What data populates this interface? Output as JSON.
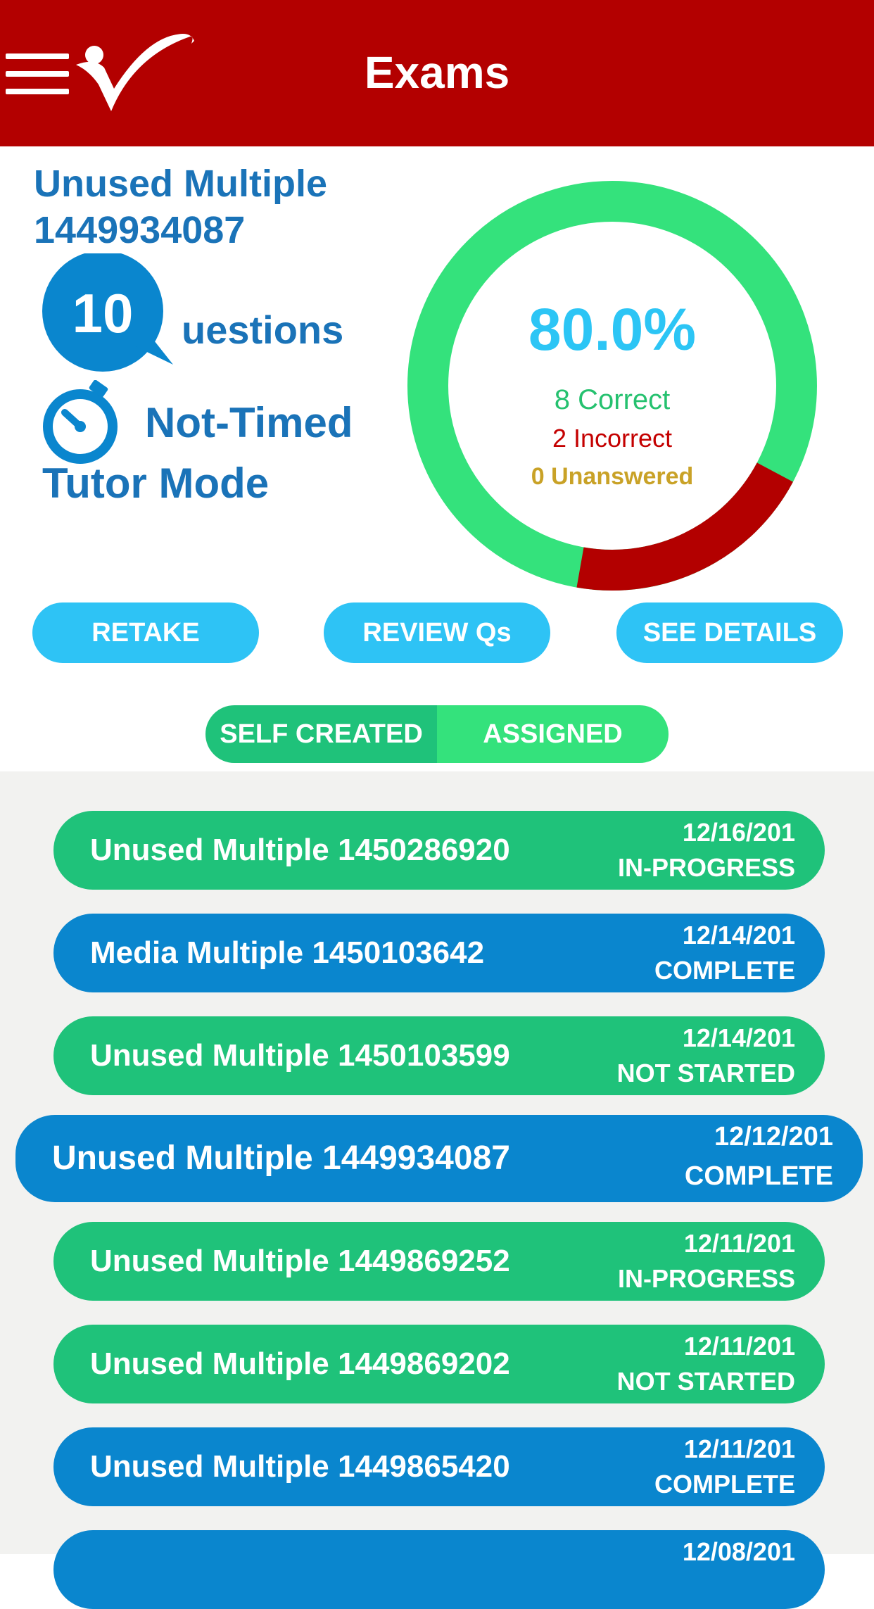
{
  "header": {
    "title": "Exams",
    "menu_icon": "hamburger-menu-icon",
    "logo_icon": "checkmark-person-logo"
  },
  "summary": {
    "exam_name": "Unused Multiple 1449934087",
    "question_count": "10",
    "question_suffix": "uestions",
    "timing": "Not-Timed",
    "mode": "Tutor Mode",
    "score_percent": "80.0%",
    "correct_label": "8 Correct",
    "incorrect_label": "2 Incorrect",
    "unanswered_label": "0 Unanswered",
    "correct_fraction": 0.8,
    "incorrect_fraction": 0.2,
    "colors": {
      "correct": "#34e27c",
      "incorrect": "#b30000",
      "accent": "#2ec3f5",
      "text": "#1a73b8"
    }
  },
  "actions": {
    "retake": "RETAKE",
    "review": "REVIEW Qs",
    "details": "SEE DETAILS"
  },
  "toggle": {
    "self_created": "SELF CREATED",
    "assigned": "ASSIGNED",
    "active": "self_created"
  },
  "exams": [
    {
      "name": "Unused Multiple 1450286920",
      "date": "12/16/201",
      "status": "IN-PROGRESS",
      "color": "#1fc27a"
    },
    {
      "name": "Media Multiple 1450103642",
      "date": "12/14/201",
      "status": "COMPLETE",
      "color": "#0a86ce"
    },
    {
      "name": "Unused Multiple 1450103599",
      "date": "12/14/201",
      "status": "NOT STARTED",
      "color": "#1fc27a"
    },
    {
      "name": "Unused Multiple 1449934087",
      "date": "12/12/201",
      "status": "COMPLETE",
      "color": "#0a86ce",
      "selected": true
    },
    {
      "name": "Unused Multiple 1449869252",
      "date": "12/11/201",
      "status": "IN-PROGRESS",
      "color": "#1fc27a"
    },
    {
      "name": "Unused Multiple 1449869202",
      "date": "12/11/201",
      "status": "NOT STARTED",
      "color": "#1fc27a"
    },
    {
      "name": "Unused Multiple 1449865420",
      "date": "12/11/201",
      "status": "COMPLETE",
      "color": "#0a86ce"
    },
    {
      "name": "",
      "date": "12/08/201",
      "status": "",
      "color": "#0a86ce"
    }
  ]
}
